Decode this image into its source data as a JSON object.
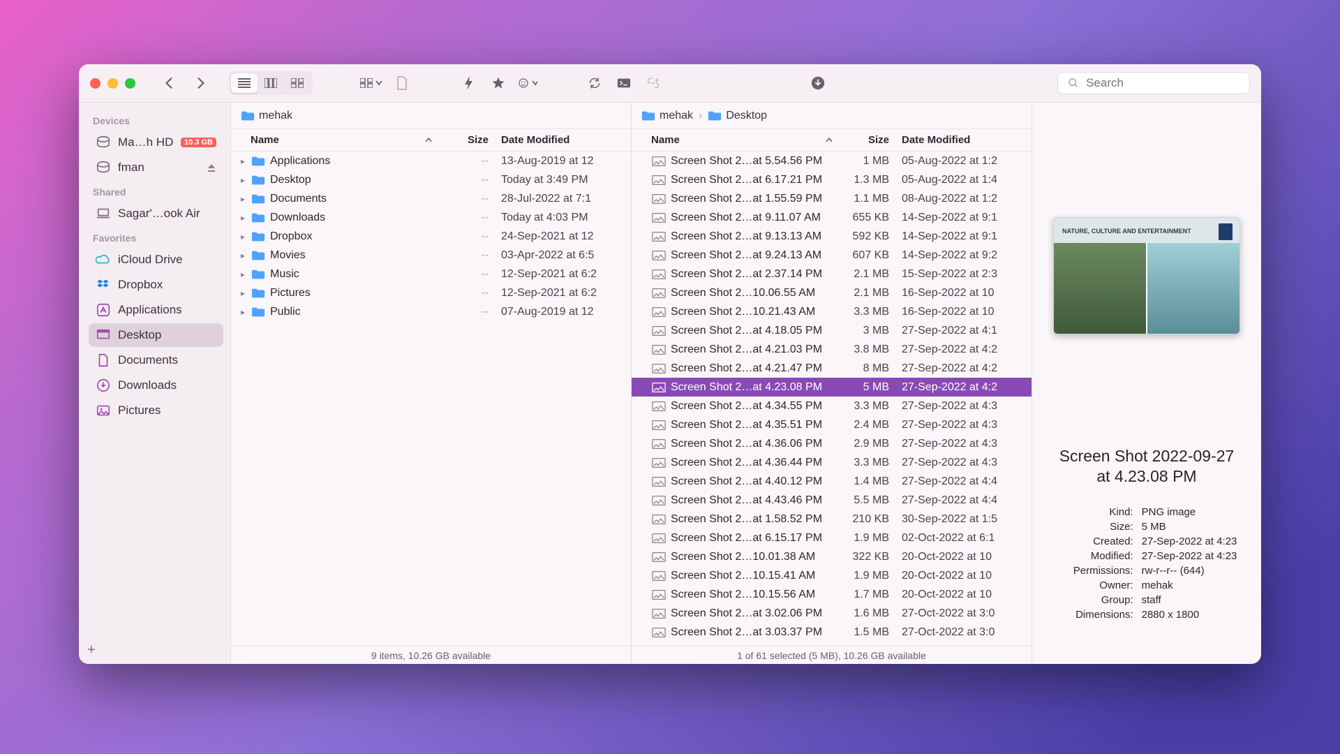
{
  "search_placeholder": "Search",
  "sidebar": {
    "sections": [
      {
        "title": "Devices",
        "items": [
          {
            "icon": "disk",
            "label": "Ma…h HD",
            "badge": "10.3 GB"
          },
          {
            "icon": "disk",
            "label": "fman",
            "eject": true
          }
        ]
      },
      {
        "title": "Shared",
        "items": [
          {
            "icon": "laptop",
            "label": "Sagar'…ook Air"
          }
        ]
      },
      {
        "title": "Favorites",
        "items": [
          {
            "icon": "cloud",
            "label": "iCloud Drive"
          },
          {
            "icon": "dropbox",
            "label": "Dropbox"
          },
          {
            "icon": "app",
            "label": "Applications"
          },
          {
            "icon": "desktop",
            "label": "Desktop",
            "selected": true
          },
          {
            "icon": "doc",
            "label": "Documents"
          },
          {
            "icon": "down",
            "label": "Downloads"
          },
          {
            "icon": "pic",
            "label": "Pictures"
          }
        ]
      }
    ]
  },
  "left_pane": {
    "path": [
      {
        "label": "mehak"
      }
    ],
    "columns": {
      "name": "Name",
      "size": "Size",
      "date": "Date Modified"
    },
    "rows": [
      {
        "name": "Applications",
        "size": "--",
        "date": "13-Aug-2019 at 12"
      },
      {
        "name": "Desktop",
        "size": "--",
        "date": "Today at 3:49 PM"
      },
      {
        "name": "Documents",
        "size": "--",
        "date": "28-Jul-2022 at 7:1"
      },
      {
        "name": "Downloads",
        "size": "--",
        "date": "Today at 4:03 PM"
      },
      {
        "name": "Dropbox",
        "size": "--",
        "date": "24-Sep-2021 at 12"
      },
      {
        "name": "Movies",
        "size": "--",
        "date": "03-Apr-2022 at 6:5"
      },
      {
        "name": "Music",
        "size": "--",
        "date": "12-Sep-2021 at 6:2"
      },
      {
        "name": "Pictures",
        "size": "--",
        "date": "12-Sep-2021 at 6:2"
      },
      {
        "name": "Public",
        "size": "--",
        "date": "07-Aug-2019 at 12"
      }
    ],
    "status": "9 items, 10.26 GB available"
  },
  "right_pane": {
    "path": [
      {
        "label": "mehak"
      },
      {
        "label": "Desktop"
      }
    ],
    "columns": {
      "name": "Name",
      "size": "Size",
      "date": "Date Modified"
    },
    "rows": [
      {
        "name": "Screen Shot 2…at 5.54.56 PM",
        "size": "1 MB",
        "date": "05-Aug-2022 at 1:2"
      },
      {
        "name": "Screen Shot 2…at 6.17.21 PM",
        "size": "1.3 MB",
        "date": "05-Aug-2022 at 1:4"
      },
      {
        "name": "Screen Shot 2…at 1.55.59 PM",
        "size": "1.1 MB",
        "date": "08-Aug-2022 at 1:2"
      },
      {
        "name": "Screen Shot 2…at 9.11.07 AM",
        "size": "655 KB",
        "date": "14-Sep-2022 at 9:1"
      },
      {
        "name": "Screen Shot 2…at 9.13.13 AM",
        "size": "592 KB",
        "date": "14-Sep-2022 at 9:1"
      },
      {
        "name": "Screen Shot 2…at 9.24.13 AM",
        "size": "607 KB",
        "date": "14-Sep-2022 at 9:2"
      },
      {
        "name": "Screen Shot 2…at 2.37.14 PM",
        "size": "2.1 MB",
        "date": "15-Sep-2022 at 2:3"
      },
      {
        "name": "Screen Shot 2…10.06.55 AM",
        "size": "2.1 MB",
        "date": "16-Sep-2022 at 10"
      },
      {
        "name": "Screen Shot 2…10.21.43 AM",
        "size": "3.3 MB",
        "date": "16-Sep-2022 at 10"
      },
      {
        "name": "Screen Shot 2…at 4.18.05 PM",
        "size": "3 MB",
        "date": "27-Sep-2022 at 4:1"
      },
      {
        "name": "Screen Shot 2…at 4.21.03 PM",
        "size": "3.8 MB",
        "date": "27-Sep-2022 at 4:2"
      },
      {
        "name": "Screen Shot 2…at 4.21.47 PM",
        "size": "8 MB",
        "date": "27-Sep-2022 at 4:2"
      },
      {
        "name": "Screen Shot 2…at 4.23.08 PM",
        "size": "5 MB",
        "date": "27-Sep-2022 at 4:2",
        "selected": true
      },
      {
        "name": "Screen Shot 2…at 4.34.55 PM",
        "size": "3.3 MB",
        "date": "27-Sep-2022 at 4:3"
      },
      {
        "name": "Screen Shot 2…at 4.35.51 PM",
        "size": "2.4 MB",
        "date": "27-Sep-2022 at 4:3"
      },
      {
        "name": "Screen Shot 2…at 4.36.06 PM",
        "size": "2.9 MB",
        "date": "27-Sep-2022 at 4:3"
      },
      {
        "name": "Screen Shot 2…at 4.36.44 PM",
        "size": "3.3 MB",
        "date": "27-Sep-2022 at 4:3"
      },
      {
        "name": "Screen Shot 2…at 4.40.12 PM",
        "size": "1.4 MB",
        "date": "27-Sep-2022 at 4:4"
      },
      {
        "name": "Screen Shot 2…at 4.43.46 PM",
        "size": "5.5 MB",
        "date": "27-Sep-2022 at 4:4"
      },
      {
        "name": "Screen Shot 2…at 1.58.52 PM",
        "size": "210 KB",
        "date": "30-Sep-2022 at 1:5"
      },
      {
        "name": "Screen Shot 2…at 6.15.17 PM",
        "size": "1.9 MB",
        "date": "02-Oct-2022 at 6:1"
      },
      {
        "name": "Screen Shot 2…10.01.38 AM",
        "size": "322 KB",
        "date": "20-Oct-2022 at 10"
      },
      {
        "name": "Screen Shot 2…10.15.41 AM",
        "size": "1.9 MB",
        "date": "20-Oct-2022 at 10"
      },
      {
        "name": "Screen Shot 2…10.15.56 AM",
        "size": "1.7 MB",
        "date": "20-Oct-2022 at 10"
      },
      {
        "name": "Screen Shot 2…at 3.02.06 PM",
        "size": "1.6 MB",
        "date": "27-Oct-2022 at 3:0"
      },
      {
        "name": "Screen Shot 2…at 3.03.37 PM",
        "size": "1.5 MB",
        "date": "27-Oct-2022 at 3:0"
      }
    ],
    "status": "1 of 61 selected (5 MB), 10.26 GB available"
  },
  "preview": {
    "thumb_caption": "NATURE, CULTURE AND ENTERTAINMENT",
    "title": "Screen Shot 2022-09-27 at 4.23.08 PM",
    "meta": [
      {
        "k": "Kind:",
        "v": "PNG image"
      },
      {
        "k": "Size:",
        "v": "5 MB"
      },
      {
        "k": "Created:",
        "v": "27-Sep-2022 at 4:23"
      },
      {
        "k": "Modified:",
        "v": "27-Sep-2022 at 4:23"
      },
      {
        "k": "Permissions:",
        "v": "rw-r--r-- (644)"
      },
      {
        "k": "Owner:",
        "v": "mehak"
      },
      {
        "k": "Group:",
        "v": "staff"
      },
      {
        "k": "Dimensions:",
        "v": "2880 x 1800"
      }
    ]
  }
}
